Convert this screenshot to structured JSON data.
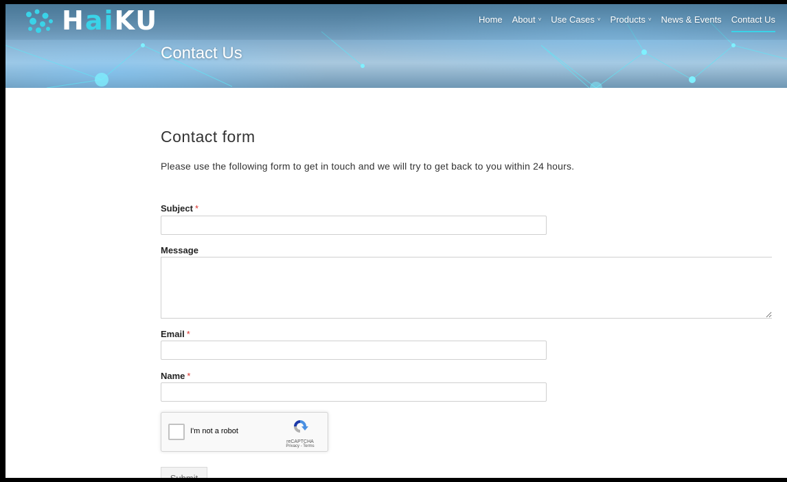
{
  "header": {
    "logo": {
      "prefix": "H",
      "accent": "ai",
      "suffix": "KU"
    },
    "nav": [
      {
        "label": "Home",
        "dropdown": false,
        "active": false
      },
      {
        "label": "About",
        "dropdown": true,
        "active": false
      },
      {
        "label": "Use Cases",
        "dropdown": true,
        "active": false
      },
      {
        "label": "Products",
        "dropdown": true,
        "active": false
      },
      {
        "label": "News & Events",
        "dropdown": false,
        "active": false
      },
      {
        "label": "Contact Us",
        "dropdown": false,
        "active": true
      }
    ],
    "caret_glyph": "˅",
    "page_title": "Contact Us"
  },
  "form": {
    "heading": "Contact form",
    "intro": "Please use the following form to get in touch and we will try to get back to you within 24 hours.",
    "required_marker": "*",
    "fields": {
      "subject": {
        "label": "Subject",
        "required": true,
        "value": ""
      },
      "message": {
        "label": "Message",
        "required": false,
        "value": ""
      },
      "email": {
        "label": "Email",
        "required": true,
        "value": ""
      },
      "name": {
        "label": "Name",
        "required": true,
        "value": ""
      }
    },
    "recaptcha": {
      "label": "I'm not a robot",
      "brand": "reCAPTCHA",
      "links": "Privacy - Terms",
      "checked": false
    },
    "submit_label": "Submit"
  },
  "colors": {
    "accent": "#3ad3e8",
    "required": "#d9302b"
  },
  "icons": {
    "logo": "network-nodes-icon",
    "nav_caret": "chevron-down-icon",
    "recaptcha": "recaptcha-icon"
  }
}
